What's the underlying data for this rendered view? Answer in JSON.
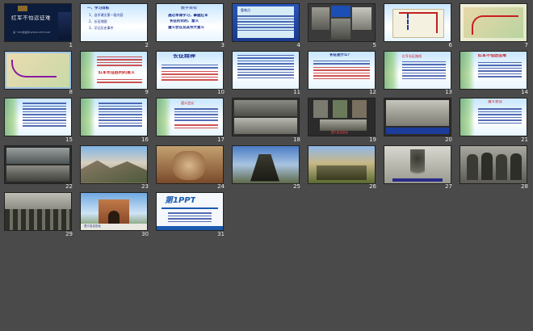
{
  "slides": [
    {
      "num": "1",
      "title": "红军不怕远征难",
      "subtitle": "第一PPT模板网-WWW.1PPT.COM"
    },
    {
      "num": "2",
      "heading": "一、学习目标",
      "lines": [
        "1、自学课文第一段内容",
        "2、长征地图",
        "3、识记历史事件"
      ]
    },
    {
      "num": "3",
      "heading": "教学目标",
      "lines": [
        "通过本课学习，掌握红军",
        "长征的目的、意义",
        "遵义会议及其伟大意义"
      ]
    },
    {
      "num": "4",
      "heading": "重难点"
    },
    {
      "num": "5",
      "caption": ""
    },
    {
      "num": "6"
    },
    {
      "num": "7"
    },
    {
      "num": "8"
    },
    {
      "num": "9",
      "caption": "红军长征胜利的意义"
    },
    {
      "num": "10",
      "heading": "长征精神"
    },
    {
      "num": "11"
    },
    {
      "num": "12",
      "heading": "长征是什么？"
    },
    {
      "num": "13",
      "heading": "红军长征路线"
    },
    {
      "num": "14",
      "heading": "红军不怕远征难"
    },
    {
      "num": "15"
    },
    {
      "num": "16"
    },
    {
      "num": "17",
      "heading": "遵义会议"
    },
    {
      "num": "18"
    },
    {
      "num": "19",
      "caption": "遵义会议旧址"
    },
    {
      "num": "20"
    },
    {
      "num": "21",
      "heading": "遵义会议"
    },
    {
      "num": "22"
    },
    {
      "num": "23"
    },
    {
      "num": "24"
    },
    {
      "num": "25"
    },
    {
      "num": "26"
    },
    {
      "num": "27"
    },
    {
      "num": "28"
    },
    {
      "num": "29"
    },
    {
      "num": "30",
      "caption": "遵义会议旧址"
    },
    {
      "num": "31",
      "logo": "第1PPT"
    }
  ]
}
